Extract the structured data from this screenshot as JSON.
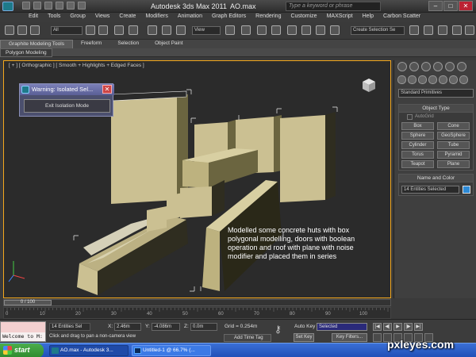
{
  "titlebar": {
    "app_title": "Autodesk 3ds Max  2011",
    "doc_title": "AO.max",
    "search_placeholder": "Type a keyword or phrase",
    "minimize": "–",
    "maximize": "□",
    "close": "✕"
  },
  "menu": [
    "Edit",
    "Tools",
    "Group",
    "Views",
    "Create",
    "Modifiers",
    "Animation",
    "Graph Editors",
    "Rendering",
    "Customize",
    "MAXScript",
    "Help",
    "Carbon Scatter"
  ],
  "toolbar": {
    "filter_all": "All",
    "ref_coord": "View",
    "selection_set": "Create Selection Se"
  },
  "ribbon": {
    "tabs": [
      "Graphite Modeling Tools",
      "Freeform",
      "Selection",
      "Object Paint"
    ],
    "sub_tab": "Polygon Modeling"
  },
  "viewport": {
    "label": "[ + ] [ Orthographic ] [ Smooth + Highlights + Edged Faces ]",
    "caption": "Modelled some concrete huts with box polygonal modelling, doors with boolean operation and roof with plane with noise modifier and placed them in series",
    "colors": {
      "border": "#f4a81d",
      "hut": "#cbc092",
      "hut_shadow": "#6b6540",
      "bg": "#2b2b2b"
    }
  },
  "warning": {
    "title": "Warning: Isolated Sel...",
    "close": "✕",
    "button": "Exit Isolation Mode"
  },
  "command_panel": {
    "dropdown": "Standard Primitives",
    "object_type_header": "Object Type",
    "autogrid": "AutoGrid",
    "primitives": [
      "Box",
      "Cone",
      "Sphere",
      "GeoSphere",
      "Cylinder",
      "Tube",
      "Torus",
      "Pyramid",
      "Teapot",
      "Plane"
    ],
    "name_color_header": "Name and Color",
    "name_value": "14 Entities Selected",
    "swatch_color": "#2d8ad6"
  },
  "timeline": {
    "frame": "0 / 100",
    "ticks": [
      "0",
      "10",
      "20",
      "30",
      "40",
      "50",
      "60",
      "70",
      "80",
      "90",
      "100"
    ]
  },
  "status": {
    "welcome": "Welcome to M:",
    "selection_count": "14 Entities Sel",
    "hint": "Click and drag to pan a non-camera view",
    "x_label": "X:",
    "x_value": "2.46m",
    "y_label": "Y:",
    "y_value": "-4.086m",
    "z_label": "Z:",
    "z_value": "0.0m",
    "grid": "Grid = 0.254m",
    "add_time_tag": "Add Time Tag",
    "auto_key": "Auto Key",
    "selected": "Selected",
    "set_key": "Set Key",
    "key_filters": "Key Filters...",
    "playback": [
      "|◀",
      "◀|",
      "▶",
      "|▶",
      "▶|"
    ]
  },
  "taskbar": {
    "start": "start",
    "items": [
      "AO.max - Autodesk 3...",
      "Untitled-1 @ 66.7% (..."
    ]
  },
  "watermark": "pxleyes.com"
}
